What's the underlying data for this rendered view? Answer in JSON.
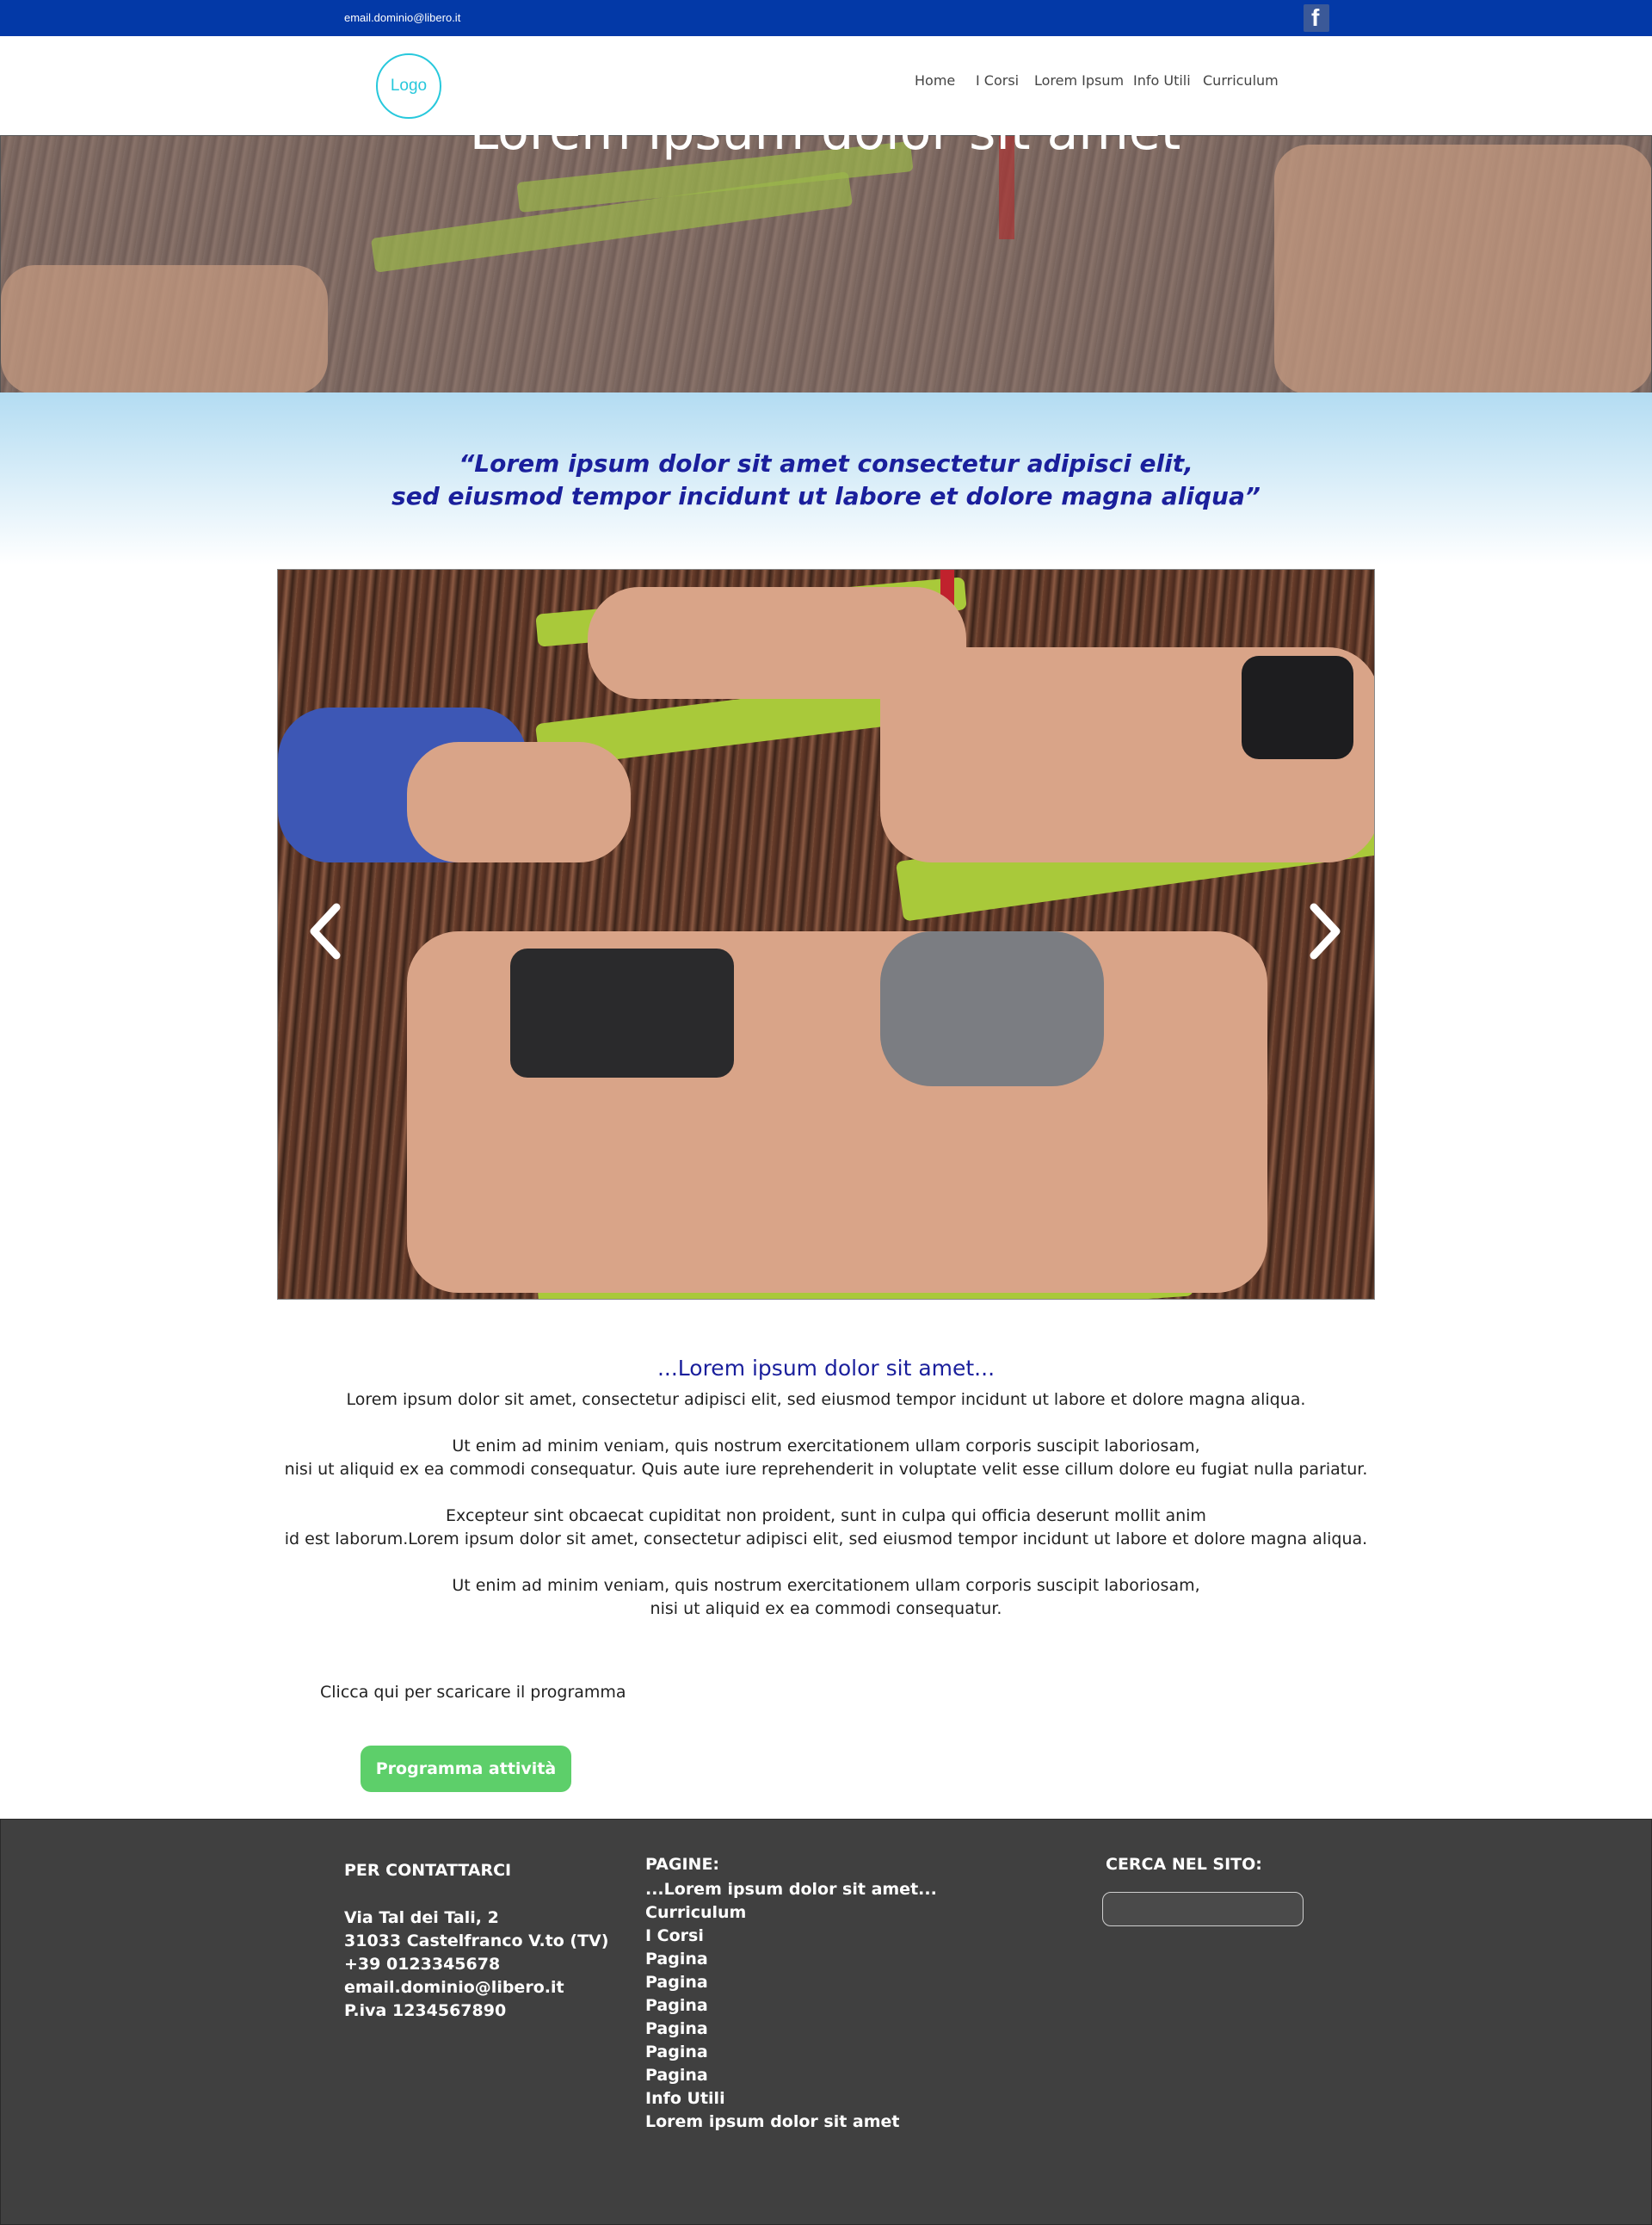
{
  "topbar": {
    "email": "email.dominio@libero.it",
    "social_icon": "facebook-icon",
    "social_glyph": "f"
  },
  "header": {
    "logo_text": "Logo",
    "nav": [
      "Home",
      "I Corsi",
      "Lorem Ipsum",
      "Info Utili",
      "Curriculum"
    ]
  },
  "hero": {
    "title": "Lorem ipsum dolor sit amet"
  },
  "quote": {
    "line1": "“Lorem ipsum dolor sit amet consectetur adipisci elit,",
    "line2": "sed eiusmod tempor incidunt ut labore et dolore magna aliqua”"
  },
  "slider": {
    "prev_icon": "chevron-left-icon",
    "next_icon": "chevron-right-icon"
  },
  "content": {
    "title": "...Lorem ipsum dolor sit amet...",
    "paragraphs": [
      "Lorem ipsum dolor sit amet, consectetur adipisci elit, sed eiusmod tempor incidunt ut labore et dolore magna aliqua.",
      "Ut enim ad minim veniam, quis nostrum exercitationem ullam corporis suscipit laboriosam,",
      "nisi ut aliquid ex ea commodi consequatur. Quis aute iure reprehenderit in voluptate velit esse cillum dolore eu fugiat nulla pariatur.",
      "Excepteur sint obcaecat cupiditat non proident, sunt in culpa qui officia deserunt mollit anim",
      "id est laborum.Lorem ipsum dolor sit amet, consectetur adipisci elit, sed eiusmod tempor incidunt ut labore et dolore magna aliqua.",
      "Ut enim ad minim veniam, quis nostrum exercitationem ullam corporis suscipit laboriosam,",
      "nisi ut aliquid ex ea commodi consequatur."
    ],
    "download_text": "Clicca qui per scaricare il programma",
    "button_label": "Programma attività"
  },
  "footer": {
    "contact": {
      "heading": "PER CONTATTARCI",
      "lines": [
        "Via Tal dei Tali, 2",
        "31033 Castelfranco V.to (TV)",
        "+39 0123345678",
        "email.dominio@libero.it",
        "P.iva 1234567890"
      ]
    },
    "pages": {
      "heading": "PAGINE:",
      "items": [
        "...Lorem ipsum dolor sit amet...",
        "Curriculum",
        "I Corsi",
        "Pagina",
        "Pagina",
        "Pagina",
        "Pagina",
        "Pagina",
        "Pagina",
        "Info Utili",
        "Lorem ipsum dolor sit amet"
      ]
    },
    "search": {
      "heading": "CERCA NEL SITO:",
      "placeholder": ""
    }
  },
  "colors": {
    "topbar": "#0339a7",
    "accent_blue": "#1a1f9c",
    "logo_cyan": "#27c8dc",
    "button_green": "#5dcf6a",
    "footer_bg": "#404040"
  }
}
